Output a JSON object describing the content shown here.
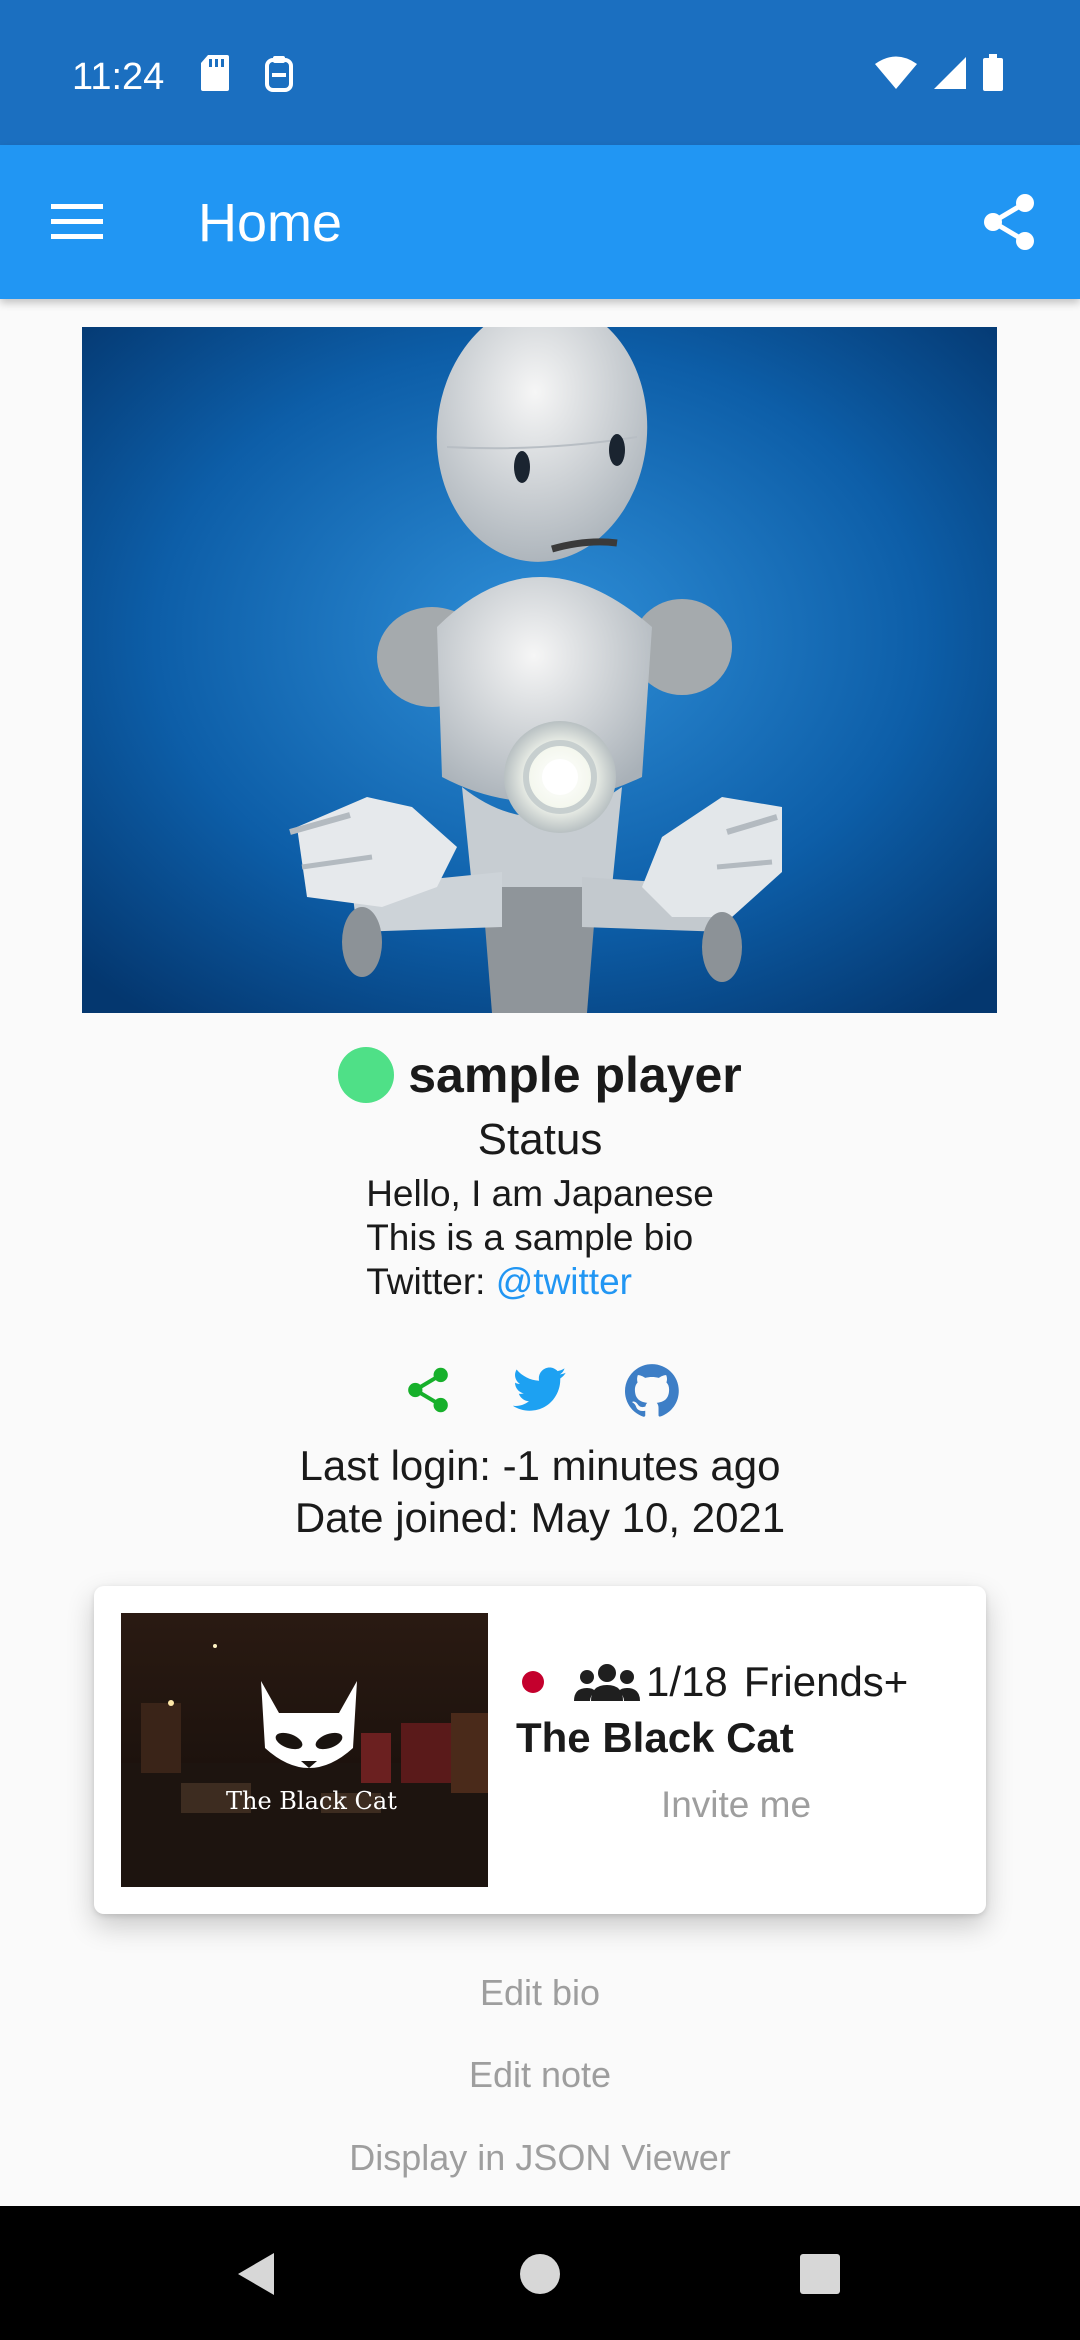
{
  "status_bar": {
    "time": "11:24",
    "left_icons": [
      "sd-card-icon",
      "clipboard-icon"
    ],
    "right_icons": [
      "wifi-icon",
      "signal-icon",
      "battery-icon"
    ]
  },
  "app_bar": {
    "title": "Home",
    "menu_icon": "hamburger-menu-icon",
    "share_icon": "share-icon",
    "color": "#2196f3"
  },
  "profile": {
    "name": "sample player",
    "online_status_color": "#4fe087",
    "status": "Status",
    "bio_line1": "Hello, I am Japanese",
    "bio_line2": "This is a sample bio",
    "twitter_label": "Twitter: ",
    "twitter_handle": "@twitter",
    "social_icons": [
      "share-icon",
      "twitter-icon",
      "github-icon"
    ],
    "last_login": "Last login: -1 minutes ago",
    "date_joined": "Date joined: May 10, 2021"
  },
  "instance": {
    "user_count": "1/18",
    "type": "Friends+",
    "world_name": "The Black Cat",
    "thumbnail_text": "The Black Cat",
    "invite_label": "Invite me"
  },
  "actions": {
    "edit_bio": "Edit bio",
    "edit_note": "Edit note",
    "json_viewer": "Display in JSON Viewer"
  },
  "nav_bar": {
    "buttons": [
      "back-icon",
      "home-icon",
      "recents-icon"
    ]
  }
}
